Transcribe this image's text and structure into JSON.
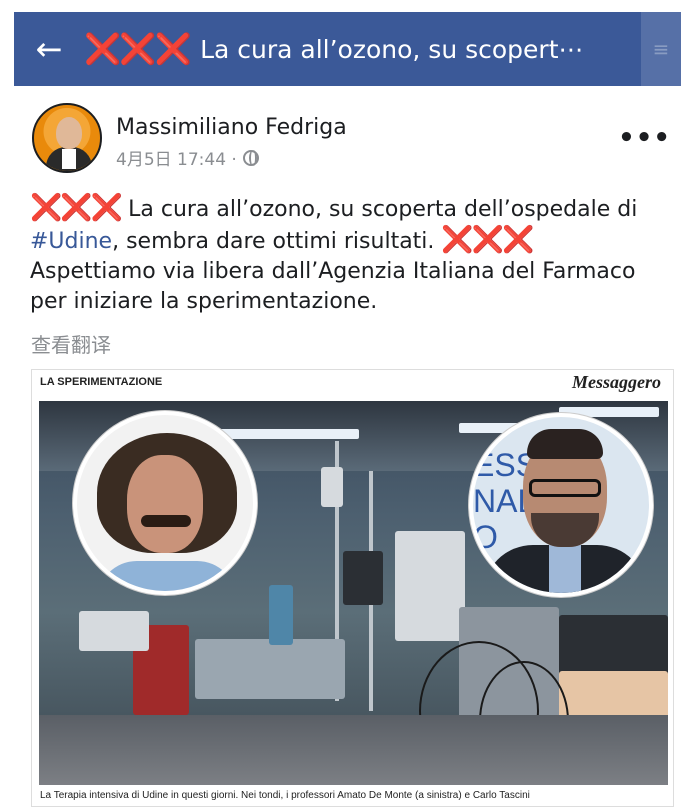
{
  "topbar": {
    "back_icon": "arrow-left-icon",
    "title_marks": "❌❌❌",
    "title": "La cura all’ozono, su scopert⋯"
  },
  "post": {
    "author": "Massimiliano Fedriga",
    "timestamp": "4月5日 17:44 ·",
    "privacy_icon": "globe-icon",
    "more_label": "•••",
    "marks": "❌❌❌",
    "text_part1": " La cura all’ozono, su scoperta dell’ospedale di ",
    "hashtag": "#Udine",
    "text_part2": ", sembra dare ottimi risultati. ",
    "text_part3": "Aspettiamo via libera dall’Agenzia Italiana del Farmaco per iniziare la sperimentazione.",
    "translate_label": "查看翻译"
  },
  "article": {
    "section_label": "LA SPERIMENTAZIONE",
    "logo": "Messaggero",
    "portrait_right_text": "ESS\nNAL\nO",
    "caption": "La Terapia intensiva di Udine in questi giorni. Nei tondi, i professori Amato De Monte (a sinistra) e Carlo Tascini"
  },
  "colors": {
    "topbar_bg": "#3b5998",
    "marks": "#d9262c",
    "hashtag": "#385898",
    "meta_gray": "#8a8d91"
  }
}
